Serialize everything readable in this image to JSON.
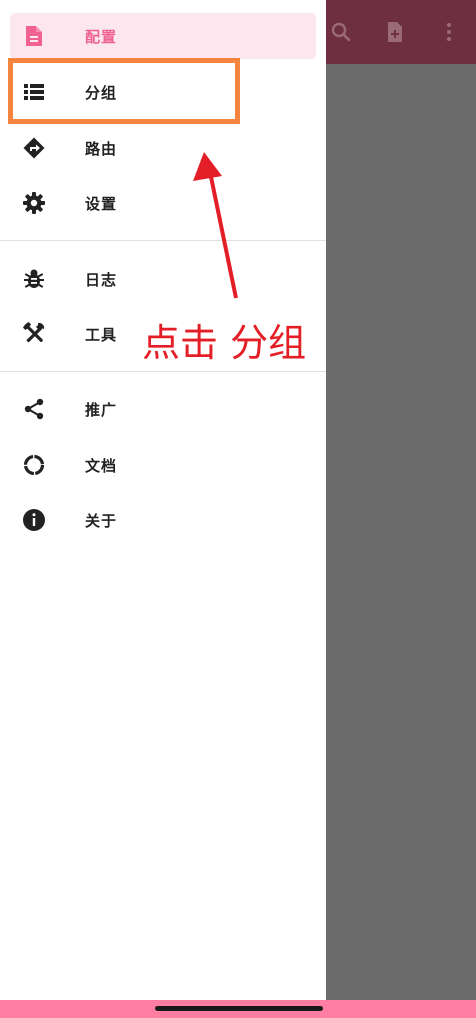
{
  "app_bar": {
    "background": "#6e2f43",
    "actions": [
      {
        "icon": "search-icon"
      },
      {
        "icon": "add-file-icon"
      },
      {
        "icon": "more-vert-icon"
      }
    ]
  },
  "drawer": {
    "selected_color": "#f06292",
    "items": [
      {
        "label": "配置",
        "icon": "description-icon",
        "selected": true
      },
      {
        "label": "分组",
        "icon": "list-icon",
        "selected": false
      },
      {
        "label": "路由",
        "icon": "directions-icon",
        "selected": false
      },
      {
        "label": "设置",
        "icon": "gear-icon",
        "selected": false
      },
      {
        "label": "日志",
        "icon": "bug-icon",
        "selected": false
      },
      {
        "label": "工具",
        "icon": "tools-icon",
        "selected": false
      },
      {
        "label": "推广",
        "icon": "share-icon",
        "selected": false
      },
      {
        "label": "文档",
        "icon": "circle-notch-icon",
        "selected": false
      },
      {
        "label": "关于",
        "icon": "info-icon",
        "selected": false
      }
    ]
  },
  "annotation": {
    "text": "点击 分组",
    "box_color": "#f5843f",
    "text_color": "#e41e26"
  },
  "nav_bar": {
    "color": "#ff7ea2"
  }
}
